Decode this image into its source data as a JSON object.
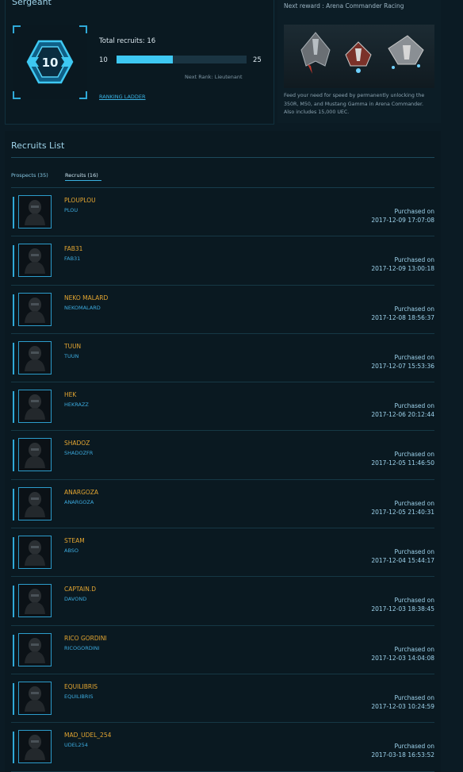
{
  "rank": {
    "title": "Sergeant",
    "badge_number": "10",
    "total_recruits_label": "Total recruits: 16",
    "progress_min": "10",
    "progress_max": "25",
    "progress_fraction": 0.43,
    "next_rank": "Next Rank: Lieutenant",
    "ranking_ladder": "RANKING LADDER"
  },
  "reward": {
    "title": "Next reward : Arena Commander Racing",
    "description": "Feed your need for speed by permanently unlocking the 350R, M50, and Mustang Gamma in Arena Commander. Also includes 15,000 UEC."
  },
  "recruits_list": {
    "title": "Recruits List",
    "tabs": [
      {
        "label": "Prospects (35)",
        "active": false
      },
      {
        "label": "Recruits (16)",
        "active": true
      }
    ],
    "purchased_label": "Purchased on",
    "rows": [
      {
        "handle": "PLOUPLOU",
        "account": "PLOU",
        "date": "2017-12-09 17:07:08"
      },
      {
        "handle": "FAB31",
        "account": "FAB31",
        "date": "2017-12-09 13:00:18"
      },
      {
        "handle": "NEKO MALARD",
        "account": "NEKOMALARD",
        "date": "2017-12-08 18:56:37"
      },
      {
        "handle": "TUUN",
        "account": "TUUN",
        "date": "2017-12-07 15:53:36"
      },
      {
        "handle": "HEK",
        "account": "HEKRAZZ",
        "date": "2017-12-06 20:12:44"
      },
      {
        "handle": "SHADOZ",
        "account": "SHADOZFR",
        "date": "2017-12-05 11:46:50"
      },
      {
        "handle": "ANARGOZA",
        "account": "ANARGOZA",
        "date": "2017-12-05 21:40:31"
      },
      {
        "handle": "STEAM",
        "account": "ABSO",
        "date": "2017-12-04 15:44:17"
      },
      {
        "handle": "CAPTAIN.D",
        "account": "DAVOND",
        "date": "2017-12-03 18:38:45"
      },
      {
        "handle": "RICO GORDINI",
        "account": "RICOGORDINI",
        "date": "2017-12-03 14:04:08"
      },
      {
        "handle": "EQUILIBRIS",
        "account": "EQUILIBRIS",
        "date": "2017-12-03 10:24:59"
      },
      {
        "handle": "MAD_UDEL_254",
        "account": "UDEL254",
        "date": "2017-03-18 16:53:52"
      }
    ]
  },
  "colors": {
    "accent": "#3ec8f2",
    "handle": "#e3a531",
    "account": "#3caade",
    "background": "#0b1b24"
  }
}
